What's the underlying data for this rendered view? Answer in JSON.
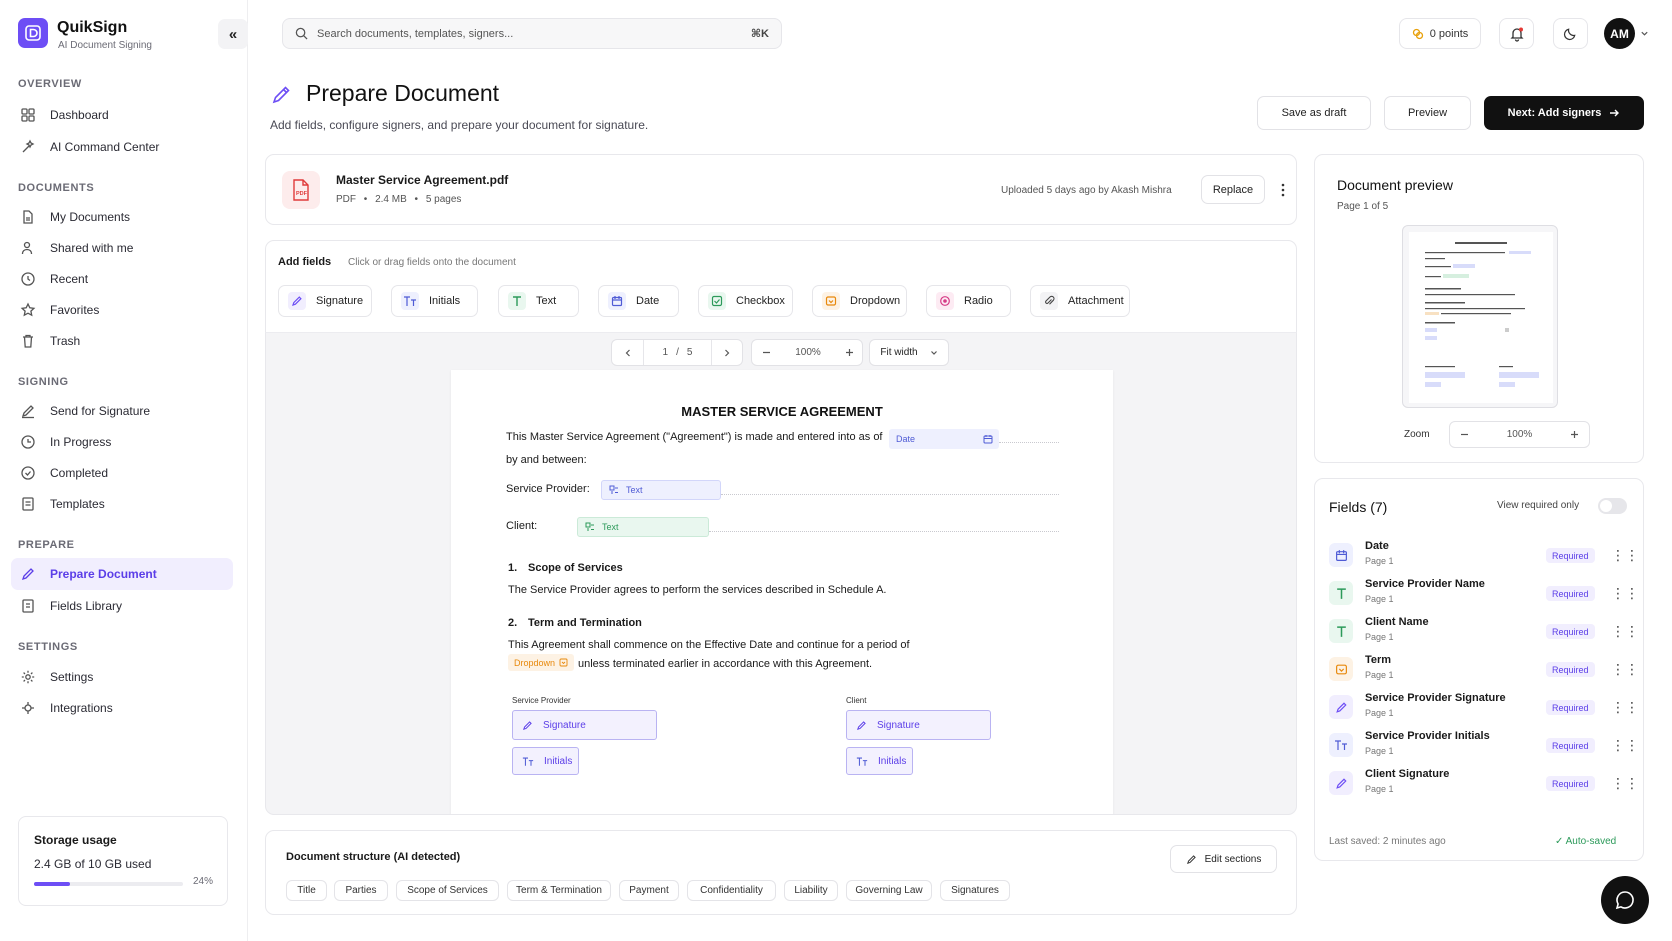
{
  "app": {
    "name": "QuikSign",
    "tagline": "AI Document Signing",
    "collapse_label": "«"
  },
  "search": {
    "placeholder": "Search documents, templates, signers...",
    "shortcut": "⌘K"
  },
  "topbar": {
    "points": "0 points",
    "avatar_initials": "AM"
  },
  "sidebar": {
    "sections": [
      {
        "title": "OVERVIEW",
        "items": [
          {
            "label": "Dashboard",
            "icon": "grid-icon"
          },
          {
            "label": "AI Command Center",
            "icon": "sparkle-icon"
          }
        ]
      },
      {
        "title": "DOCUMENTS",
        "items": [
          {
            "label": "My Documents",
            "icon": "file-icon"
          },
          {
            "label": "Shared with me",
            "icon": "users-icon"
          },
          {
            "label": "Recent",
            "icon": "clock-icon"
          },
          {
            "label": "Favorites",
            "icon": "star-icon"
          },
          {
            "label": "Trash",
            "icon": "trash-icon"
          }
        ]
      },
      {
        "title": "SIGNING",
        "items": [
          {
            "label": "Send for Signature",
            "icon": "send-icon"
          },
          {
            "label": "In Progress",
            "icon": "progress-icon"
          },
          {
            "label": "Completed",
            "icon": "check-circle-icon"
          },
          {
            "label": "Templates",
            "icon": "template-icon"
          }
        ]
      },
      {
        "title": "PREPARE",
        "items": [
          {
            "label": "Prepare Document",
            "icon": "pen-icon",
            "active": true
          },
          {
            "label": "Fields Library",
            "icon": "library-icon"
          }
        ]
      },
      {
        "title": "SETTINGS",
        "items": [
          {
            "label": "Settings",
            "icon": "gear-icon"
          },
          {
            "label": "Integrations",
            "icon": "plug-icon"
          }
        ]
      }
    ],
    "storage": {
      "title": "Storage usage",
      "used": "2.4 GB of 10 GB used",
      "percent_label": "24%",
      "fraction": 0.24
    }
  },
  "header": {
    "title": "Prepare Document",
    "subtitle": "Add fields, configure signers, and prepare your document for signature.",
    "save_draft": "Save as draft",
    "preview": "Preview",
    "next": "Next: Add signers"
  },
  "file": {
    "name": "Master Service Agreement.pdf",
    "type": "PDF",
    "size": "2.4 MB",
    "pages": "5 pages",
    "uploaded": "Uploaded 5 days ago by Akash Mishra",
    "replace": "Replace"
  },
  "add_fields": {
    "title": "Add fields",
    "hint": "Click or drag fields onto the document",
    "items": [
      "Signature",
      "Initials",
      "Text",
      "Date",
      "Checkbox",
      "Dropdown",
      "Radio",
      "Attachment"
    ]
  },
  "viewer": {
    "page_current": "1",
    "page_sep": "/",
    "page_total": "5",
    "zoom": "100%",
    "fit": "Fit width"
  },
  "document": {
    "title": "MASTER SERVICE AGREEMENT",
    "intro": "This Master Service Agreement (\"Agreement\") is made and entered into as of",
    "intro2": "by and between:",
    "provider_label": "Service Provider:",
    "client_label": "Client:",
    "date_field": "Date",
    "text_field": "Text",
    "s1_num": "1.",
    "s1_title": "Scope of Services",
    "s1_body": "The Service Provider agrees to perform the services described in Schedule A.",
    "s2_num": "2.",
    "s2_title": "Term and Termination",
    "s2_body": "This Agreement shall commence on the Effective Date and continue for a period of",
    "dropdown_field": "Dropdown",
    "s2_body2": "unless terminated earlier in accordance with this Agreement.",
    "sig_provider": "Service Provider",
    "sig_client": "Client",
    "signature_field": "Signature",
    "initials_field": "Initials"
  },
  "structure": {
    "title": "Document structure (AI detected)",
    "edit": "Edit sections",
    "chips": [
      "Title",
      "Parties",
      "Scope of Services",
      "Term & Termination",
      "Payment",
      "Confidentiality",
      "Liability",
      "Governing Law",
      "Signatures"
    ]
  },
  "preview_panel": {
    "title": "Document preview",
    "page": "Page 1 of 5",
    "zoom_label": "Zoom",
    "zoom": "100%"
  },
  "fields_panel": {
    "title": "Fields (7)",
    "toggle_label": "View required only",
    "required_label": "Required",
    "items": [
      {
        "name": "Date",
        "page": "Page 1",
        "type": "date"
      },
      {
        "name": "Service Provider Name",
        "page": "Page 1",
        "type": "text"
      },
      {
        "name": "Client Name",
        "page": "Page 1",
        "type": "text"
      },
      {
        "name": "Term",
        "page": "Page 1",
        "type": "dropdown"
      },
      {
        "name": "Service Provider Signature",
        "page": "Page 1",
        "type": "signature"
      },
      {
        "name": "Service Provider Initials",
        "page": "Page 1",
        "type": "initials"
      },
      {
        "name": "Client Signature",
        "page": "Page 1",
        "type": "signature"
      }
    ],
    "last_saved": "Last saved: 2 minutes ago",
    "auto_saved": "✓ Auto-saved"
  },
  "colors": {
    "accent": "#6d4ef5",
    "text_green": "#2c9a5a",
    "dropdown_orange": "#e8890c",
    "pdf_red": "#e03b3b"
  }
}
